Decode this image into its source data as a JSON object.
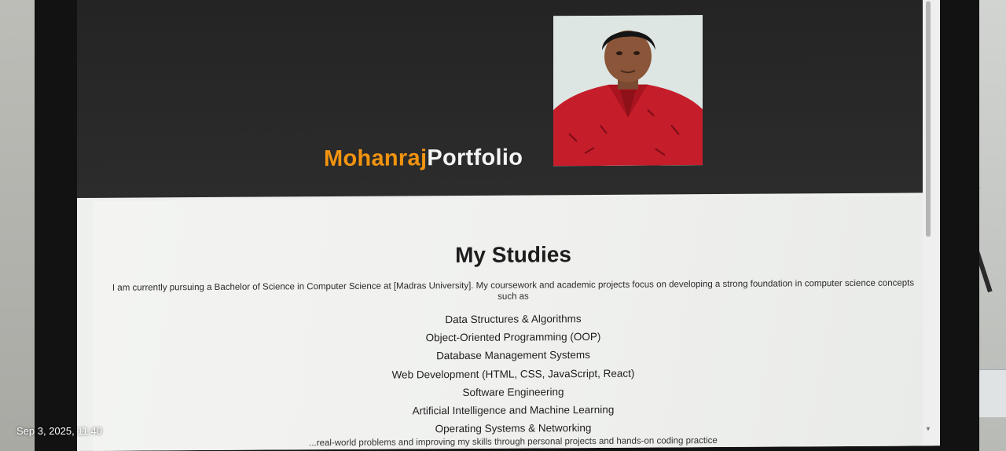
{
  "page": {
    "brand_first": "Mohanraj",
    "brand_last": "Portfolio",
    "title": "My Studies",
    "intro": "I am currently pursuing a Bachelor of Science in Computer Science at [Madras University]. My coursework and academic projects focus on developing a strong foundation in computer science concepts such as",
    "topics": [
      "Data Structures & Algorithms",
      "Object-Oriented Programming (OOP)",
      "Database Management Systems",
      "Web Development (HTML, CSS, JavaScript, React)",
      "Software Engineering",
      "Artificial Intelligence and Machine Learning",
      "Operating Systems & Networking"
    ],
    "outro": "...real-world problems and improving my skills through personal projects and hands-on coding practice"
  },
  "photo": {
    "timestamp": "Sep 3, 2025, 11:40"
  },
  "colors": {
    "accent": "#f2940f",
    "hero_bg": "#2a2a2a"
  }
}
